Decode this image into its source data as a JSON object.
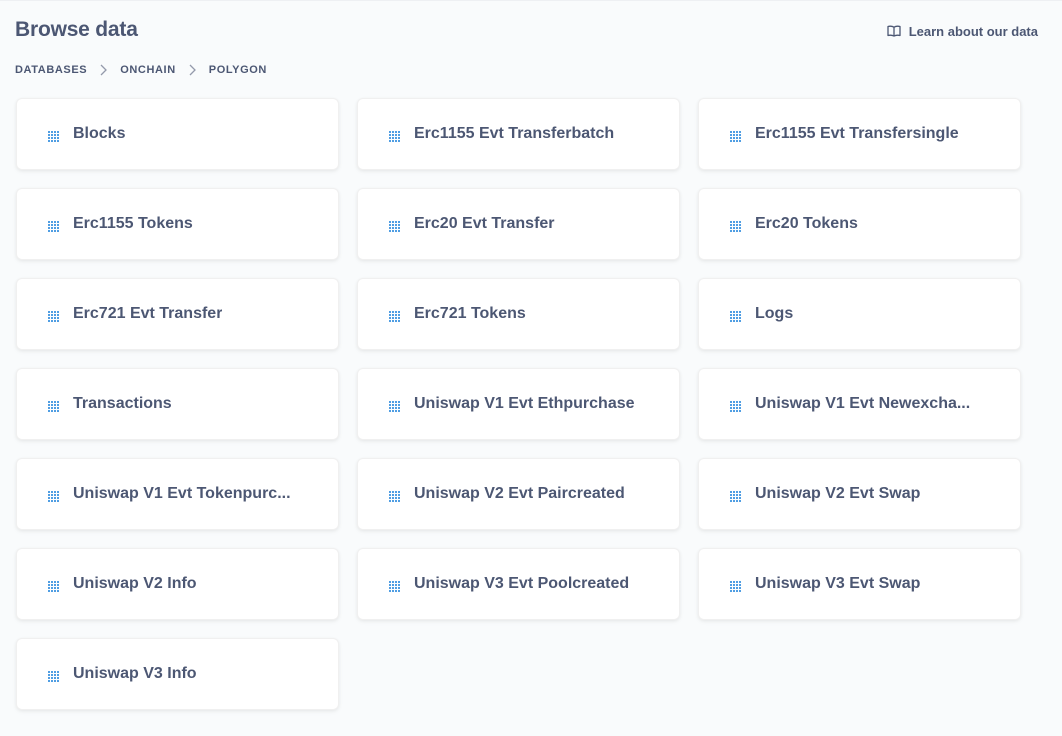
{
  "header": {
    "title": "Browse data",
    "learn_link": {
      "label": "Learn about our data",
      "icon": "book-icon"
    }
  },
  "breadcrumb": {
    "items": [
      "Databases",
      "Onchain",
      "Polygon"
    ],
    "separator_icon": "chevron-right-icon"
  },
  "colors": {
    "text": "#4c5773",
    "icon_accent": "#509ee3",
    "background": "#f9fbfc",
    "card": "#ffffff"
  },
  "tables": [
    {
      "label": "Blocks",
      "icon": "table-grid-icon"
    },
    {
      "label": "Erc1155 Evt Transferbatch",
      "icon": "table-grid-icon"
    },
    {
      "label": "Erc1155 Evt Transfersingle",
      "icon": "table-grid-icon"
    },
    {
      "label": "Erc1155 Tokens",
      "icon": "table-grid-icon"
    },
    {
      "label": "Erc20 Evt Transfer",
      "icon": "table-grid-icon"
    },
    {
      "label": "Erc20 Tokens",
      "icon": "table-grid-icon"
    },
    {
      "label": "Erc721 Evt Transfer",
      "icon": "table-grid-icon"
    },
    {
      "label": "Erc721 Tokens",
      "icon": "table-grid-icon"
    },
    {
      "label": "Logs",
      "icon": "table-grid-icon"
    },
    {
      "label": "Transactions",
      "icon": "table-grid-icon"
    },
    {
      "label": "Uniswap V1 Evt Ethpurchase",
      "icon": "table-grid-icon"
    },
    {
      "label": "Uniswap V1 Evt Newexcha...",
      "icon": "table-grid-icon"
    },
    {
      "label": "Uniswap V1 Evt Tokenpurc...",
      "icon": "table-grid-icon"
    },
    {
      "label": "Uniswap V2 Evt Paircreated",
      "icon": "table-grid-icon"
    },
    {
      "label": "Uniswap V2 Evt Swap",
      "icon": "table-grid-icon"
    },
    {
      "label": "Uniswap V2 Info",
      "icon": "table-grid-icon"
    },
    {
      "label": "Uniswap V3 Evt Poolcreated",
      "icon": "table-grid-icon"
    },
    {
      "label": "Uniswap V3 Evt Swap",
      "icon": "table-grid-icon"
    },
    {
      "label": "Uniswap V3 Info",
      "icon": "table-grid-icon"
    }
  ]
}
